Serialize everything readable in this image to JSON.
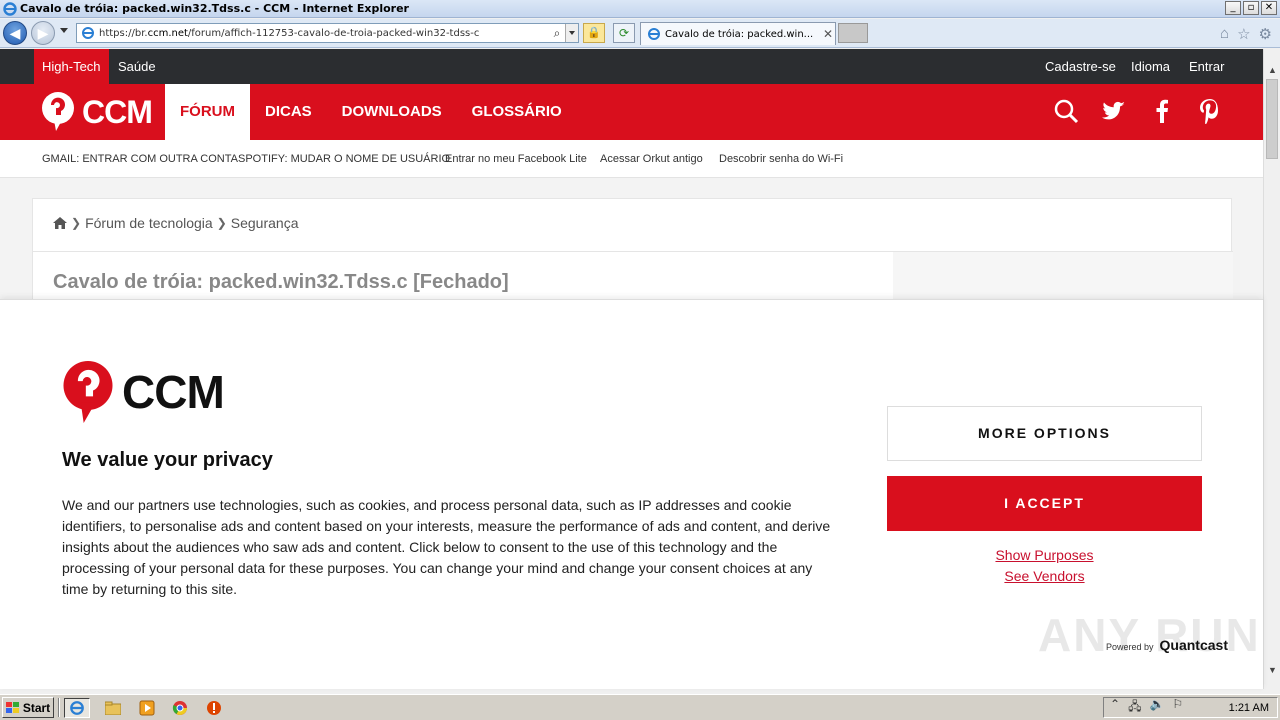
{
  "window": {
    "title": "Cavalo de tróia: packed.win32.Tdss.c - CCM - Internet Explorer",
    "controls": [
      "_",
      "▫",
      "✕"
    ]
  },
  "browser": {
    "url_prefix": "https://br.",
    "url_domain": "ccm.net",
    "url_path": "/forum/affich-112753-cavalo-de-troia-packed-win32-tdss-c",
    "tab_title": "Cavalo de tróia: packed.win..."
  },
  "site": {
    "top_nav": [
      "High-Tech",
      "Saúde"
    ],
    "top_right": [
      "Cadastre-se",
      "Idioma",
      "Entrar"
    ],
    "logo_text": "CCM",
    "main_nav": [
      "FÓRUM",
      "DICAS",
      "DOWNLOADS",
      "GLOSSÁRIO"
    ],
    "quick_links": [
      "GMAIL: ENTRAR COM OUTRA CONTA",
      "SPOTIFY: MUDAR O NOME DE USUÁRIO",
      "Entrar no meu Facebook Lite",
      "Acessar Orkut antigo",
      "Descobrir senha do Wi-Fi"
    ],
    "breadcrumb": [
      "Fórum de tecnologia",
      "Segurança"
    ],
    "page_title": "Cavalo de tróia: packed.win32.Tdss.c [Fechado]"
  },
  "consent": {
    "logo_text": "CCM",
    "title": "We value your privacy",
    "body": "We and our partners use technologies, such as cookies, and process personal data, such as IP addresses and cookie identifiers, to personalise ads and content based on your interests, measure the performance of ads and content, and derive insights about the audiences who saw ads and content. Click below to consent to the use of this technology and the processing of your personal data for these purposes. You can change your mind and change your consent choices at any time by returning to this site.",
    "more_options": "MORE OPTIONS",
    "accept": "I ACCEPT",
    "show_purposes": "Show Purposes",
    "see_vendors": "See Vendors",
    "powered_by": "Powered by",
    "provider": "Quantcast"
  },
  "watermark": "ANY RUN",
  "taskbar": {
    "start": "Start",
    "clock": "1:21 AM"
  },
  "colors": {
    "brand_red": "#d90f1d",
    "dark_bar": "#2b2d30",
    "link_red": "#c8102e"
  }
}
